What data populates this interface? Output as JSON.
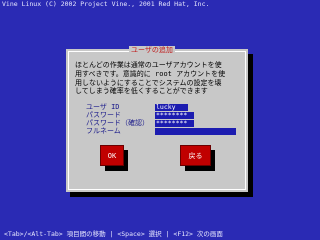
{
  "header": {
    "copyright": "Vine Linux (C) 2002 Project Vine., 2001 Red Hat, Inc."
  },
  "dialog": {
    "title": "ユーザの追加",
    "description_lines": [
      "ほとんどの作業は通常のユーザアカウントを使",
      "用すべきです。意識的に root アカウントを使",
      "用しないようにすることでシステムの設定を壊",
      "してしまう確率を低くすることができます"
    ],
    "fields": [
      {
        "label": "ユーザ ID",
        "value": "lucky"
      },
      {
        "label": "パスワード",
        "value": "********"
      },
      {
        "label": "パスワード（確認）",
        "value": "********"
      },
      {
        "label": "フルネーム",
        "value": ""
      }
    ],
    "ok_label": "OK",
    "back_label": "戻る"
  },
  "statusbar": {
    "help": "<Tab>/<Alt-Tab> 項目間の移動 | <Space> 選択 | <F12> 次の画面"
  }
}
